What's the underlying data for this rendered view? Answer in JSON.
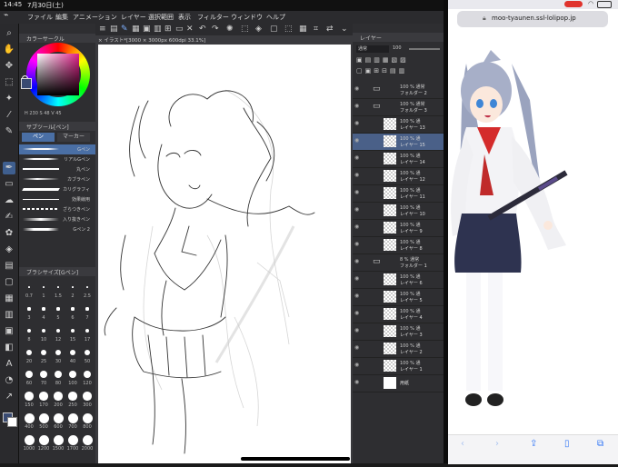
{
  "status": {
    "time": "14:45",
    "date": "7月30日(土)"
  },
  "menu": [
    "ファイル",
    "編集",
    "アニメーション",
    "レイヤー",
    "選択範囲",
    "表示",
    "フィルター",
    "ウィンドウ",
    "ヘルプ"
  ],
  "color_panel": {
    "title": "カラーサークル",
    "main_color": "#3a4b72",
    "hsv_readout": "H 230 S 48 V 45"
  },
  "subtool": {
    "title": "サブツール[ペン]",
    "tabs": [
      "ペン",
      "マーカー"
    ],
    "brushes": [
      {
        "label": "Gペン",
        "selected": true
      },
      {
        "label": "リアルGペン",
        "selected": false
      },
      {
        "label": "丸ペン",
        "selected": false
      },
      {
        "label": "カブラペン",
        "selected": false
      },
      {
        "label": "カリグラフィ",
        "selected": false
      },
      {
        "label": "効果線用",
        "selected": false
      },
      {
        "label": "ざらつきペン",
        "selected": false
      },
      {
        "label": "入り抜きペン",
        "selected": false
      },
      {
        "label": "Gペン 2",
        "selected": false
      }
    ]
  },
  "brush_size": {
    "title": "ブラシサイズ[Gペン]",
    "row1": [
      "0.7",
      "1",
      "1.5",
      "2",
      "2.5"
    ],
    "row2": [
      "3",
      "4",
      "5",
      "6",
      "7"
    ],
    "row3": [
      "8",
      "10",
      "12",
      "15",
      "17"
    ],
    "row4": [
      "20",
      "25",
      "30",
      "40",
      "50"
    ],
    "row5": [
      "60",
      "70",
      "80",
      "100",
      "120"
    ],
    "row6": [
      "150",
      "170",
      "200",
      "250",
      "300"
    ],
    "row7": [
      "400",
      "500",
      "600",
      "700",
      "800"
    ],
    "row8": [
      "1000",
      "1200",
      "1500",
      "1700",
      "2000"
    ]
  },
  "canvas": {
    "tab_label": "× イラスト*[3000 × 3000px 600dpi 33.1%]"
  },
  "layer_panel": {
    "title": "レイヤー",
    "blend_mode": "通常",
    "opacity": "100",
    "layers": [
      {
        "blend": "100 % 通常",
        "name": "フォルダー 2",
        "folder": true
      },
      {
        "blend": "100 % 通常",
        "name": "フォルダー 3",
        "folder": true
      },
      {
        "blend": "100 % 通",
        "name": "レイヤー 13",
        "folder": false
      },
      {
        "blend": "100 % 通",
        "name": "レイヤー 15",
        "folder": false,
        "selected": true
      },
      {
        "blend": "100 % 通",
        "name": "レイヤー 14",
        "folder": false
      },
      {
        "blend": "100 % 通",
        "name": "レイヤー 12",
        "folder": false
      },
      {
        "blend": "100 % 通",
        "name": "レイヤー 11",
        "folder": false
      },
      {
        "blend": "100 % 通",
        "name": "レイヤー 10",
        "folder": false
      },
      {
        "blend": "100 % 通",
        "name": "レイヤー 9",
        "folder": false
      },
      {
        "blend": "100 % 通",
        "name": "レイヤー 8",
        "folder": false
      },
      {
        "blend": "8 % 通常",
        "name": "フォルダー 1",
        "folder": true
      },
      {
        "blend": "100 % 通",
        "name": "レイヤー 6",
        "folder": false
      },
      {
        "blend": "100 % 通",
        "name": "レイヤー 5",
        "folder": false
      },
      {
        "blend": "100 % 通",
        "name": "レイヤー 4",
        "folder": false
      },
      {
        "blend": "100 % 通",
        "name": "レイヤー 3",
        "folder": false
      },
      {
        "blend": "100 % 通",
        "name": "レイヤー 2",
        "folder": false
      },
      {
        "blend": "100 % 通",
        "name": "レイヤー 1",
        "folder": false
      },
      {
        "blend": "",
        "name": "用紙",
        "folder": false,
        "paper": true
      }
    ]
  },
  "browser": {
    "url": "moo-tyaunen.ssl-lolipop.jp",
    "recording_color": "#e0332d"
  }
}
